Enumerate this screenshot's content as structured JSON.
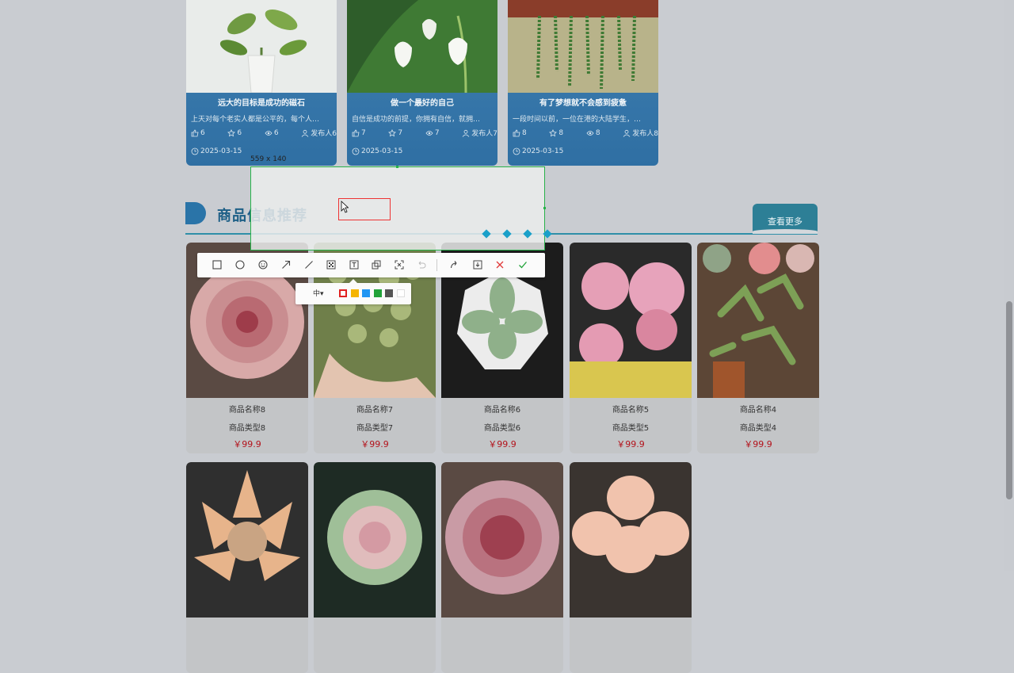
{
  "articles": [
    {
      "title": "远大的目标是成功的磁石",
      "desc": "上天对每个老实人都是公平的，每个人…",
      "likes": "6",
      "stars": "6",
      "views": "6",
      "author": "发布人6",
      "date": "2025-03-15"
    },
    {
      "title": "做一个最好的自己",
      "desc": "自信是成功的前提，你拥有自信，就拥…",
      "likes": "7",
      "stars": "7",
      "views": "7",
      "author": "发布人7",
      "date": "2025-03-15"
    },
    {
      "title": "有了梦想就不会感到疲惫",
      "desc": "一段时间以前，一位在港的大陆学生，…",
      "likes": "8",
      "stars": "8",
      "views": "8",
      "author": "发布人8",
      "date": "2025-03-15"
    }
  ],
  "section": {
    "title": "商品信息推荐",
    "more_label": "查看更多"
  },
  "products": [
    {
      "name": "商品名称8",
      "type": "商品类型8",
      "price": "￥99.9"
    },
    {
      "name": "商品名称7",
      "type": "商品类型7",
      "price": "￥99.9"
    },
    {
      "name": "商品名称6",
      "type": "商品类型6",
      "price": "￥99.9"
    },
    {
      "name": "商品名称5",
      "type": "商品类型5",
      "price": "￥99.9"
    },
    {
      "name": "商品名称4",
      "type": "商品类型4",
      "price": "￥99.9"
    },
    {
      "name": "",
      "type": "",
      "price": ""
    },
    {
      "name": "",
      "type": "",
      "price": ""
    },
    {
      "name": "",
      "type": "",
      "price": ""
    },
    {
      "name": "",
      "type": "",
      "price": ""
    }
  ],
  "screenshot_tool": {
    "size_label": "559 x 140",
    "font_size_option": "中",
    "colors": [
      "#e02020",
      "#f5b400",
      "#2196f3",
      "#22a33a",
      "#555555",
      "#ffffff"
    ],
    "tools": [
      "rectangle-icon",
      "ellipse-icon",
      "emoji-icon",
      "arrow-icon",
      "line-icon",
      "mosaic-icon",
      "text-icon",
      "copy-icon",
      "ocr-icon",
      "undo-icon",
      "redo-icon",
      "save-icon",
      "cancel-icon",
      "confirm-icon"
    ]
  },
  "colors": {
    "accent": "#1d5f86",
    "price": "#b3121b",
    "selection": "#28b24a"
  }
}
